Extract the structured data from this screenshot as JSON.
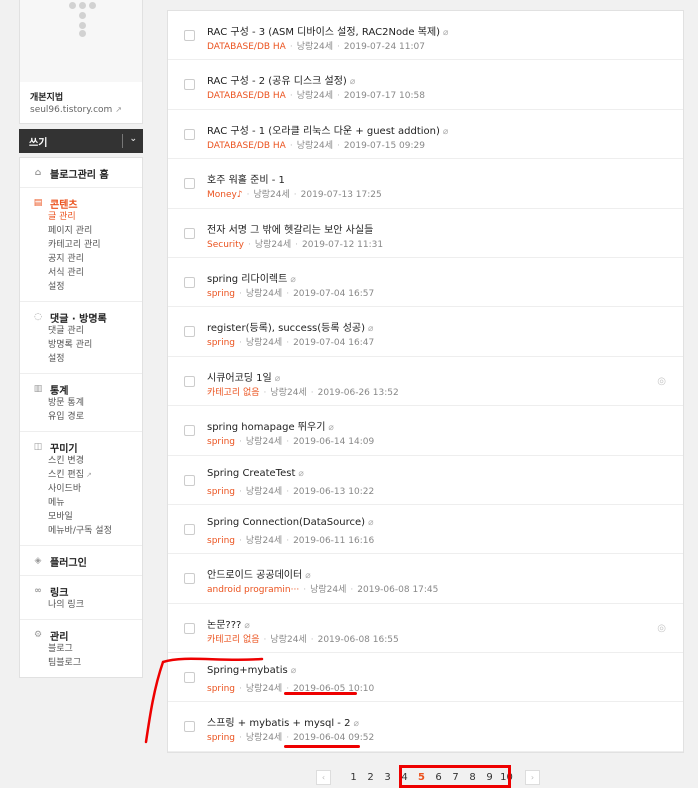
{
  "blog": {
    "name": "개본지법",
    "url": "seul96.tistory.com"
  },
  "write": {
    "label": "쓰기"
  },
  "menu": [
    {
      "title": "블로그관리 홈",
      "icon": "home-icon",
      "items": []
    },
    {
      "title": "콘텐츠",
      "icon": "document-icon",
      "items": [
        "글 관리",
        "페이지 관리",
        "카테고리 관리",
        "공지 관리",
        "서식 관리",
        "설정"
      ]
    },
    {
      "title": "댓글 · 방명록",
      "icon": "comment-icon",
      "items": [
        "댓글 관리",
        "방명록 관리",
        "설정"
      ]
    },
    {
      "title": "통계",
      "icon": "chart-icon",
      "items": [
        "방문 통계",
        "유입 경로"
      ]
    },
    {
      "title": "꾸미기",
      "icon": "layout-icon",
      "items": [
        "스킨 변경",
        "스킨 편집",
        "사이드바",
        "메뉴",
        "모바일",
        "메뉴바/구독 설정"
      ]
    },
    {
      "title": "플러그인",
      "icon": "plugin-icon",
      "items": []
    },
    {
      "title": "링크",
      "icon": "link-icon",
      "items": [
        "나의 링크"
      ]
    },
    {
      "title": "관리",
      "icon": "gear-icon",
      "items": [
        "블로그",
        "팀블로그"
      ]
    }
  ],
  "posts": [
    {
      "title": "RAC 구성 - 3 (ASM 디바이스 설정, RAC2Node 복제)",
      "category": "DATABASE/DB HA",
      "author": "낭랑24세",
      "date": "2019-07-24 11:07",
      "attach": true,
      "eye": false
    },
    {
      "title": "RAC 구성 - 2 (공유 디스크 설정)",
      "category": "DATABASE/DB HA",
      "author": "낭랑24세",
      "date": "2019-07-17 10:58",
      "attach": true,
      "eye": false
    },
    {
      "title": "RAC 구성 - 1 (오라클 리눅스 다운 + guest addtion)",
      "category": "DATABASE/DB HA",
      "author": "낭랑24세",
      "date": "2019-07-15 09:29",
      "attach": true,
      "eye": false
    },
    {
      "title": "호주 워홀 준비 - 1",
      "category": "Money♪",
      "author": "낭랑24세",
      "date": "2019-07-13 17:25",
      "attach": false,
      "eye": false
    },
    {
      "title": "전자 서명 그 밖에 헷갈리는 보안 사실들",
      "category": "Security",
      "author": "낭랑24세",
      "date": "2019-07-12 11:31",
      "attach": false,
      "eye": false
    },
    {
      "title": "spring 리다이렉트",
      "category": "spring",
      "author": "낭랑24세",
      "date": "2019-07-04 16:57",
      "attach": true,
      "eye": false
    },
    {
      "title": "register(등록), success(등록 성공)",
      "category": "spring",
      "author": "낭랑24세",
      "date": "2019-07-04 16:47",
      "attach": true,
      "eye": false
    },
    {
      "title": "시큐어코딩 1일",
      "category": "카테고리 없음",
      "author": "낭랑24세",
      "date": "2019-06-26 13:52",
      "attach": true,
      "eye": true
    },
    {
      "title": "spring homapage 뛰우기",
      "category": "spring",
      "author": "낭랑24세",
      "date": "2019-06-14 14:09",
      "attach": true,
      "eye": false
    },
    {
      "title": "Spring CreateTest",
      "category": "spring",
      "author": "낭랑24세",
      "date": "2019-06-13 10:22",
      "attach": true,
      "eye": false
    },
    {
      "title": "Spring Connection(DataSource)",
      "category": "spring",
      "author": "낭랑24세",
      "date": "2019-06-11 16:16",
      "attach": true,
      "eye": false
    },
    {
      "title": "안드로이드 공공데이터",
      "category": "android programin···",
      "author": "낭랑24세",
      "date": "2019-06-08 17:45",
      "attach": true,
      "eye": false
    },
    {
      "title": "논문???",
      "category": "카테고리 없음",
      "author": "낭랑24세",
      "date": "2019-06-08 16:55",
      "attach": true,
      "eye": true
    },
    {
      "title": "Spring+mybatis",
      "category": "spring",
      "author": "낭랑24세",
      "date": "2019-06-05 10:10",
      "attach": true,
      "eye": false
    },
    {
      "title": "스프링 + mybatis + mysql - 2",
      "category": "spring",
      "author": "낭랑24세",
      "date": "2019-06-04 09:52",
      "attach": true,
      "eye": false
    }
  ],
  "pagination": {
    "prev": "‹",
    "next": "›",
    "pages": [
      "1",
      "2",
      "3",
      "4",
      "5",
      "6",
      "7",
      "8",
      "9",
      "10"
    ],
    "current": "5"
  },
  "colors": {
    "accent": "#eb531f",
    "annotation": "#e00000"
  }
}
